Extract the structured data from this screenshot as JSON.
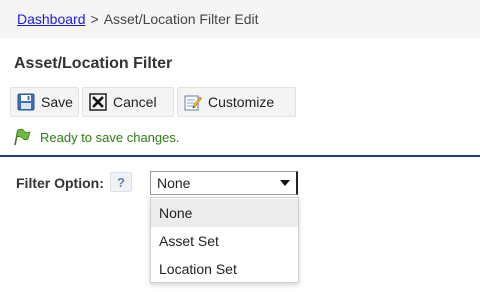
{
  "breadcrumb": {
    "home": "Dashboard",
    "separator": ">",
    "current": "Asset/Location Filter Edit"
  },
  "page_title": "Asset/Location Filter",
  "toolbar": {
    "save_label": "Save",
    "cancel_label": "Cancel",
    "customize_label": "Customize"
  },
  "status": {
    "message": "Ready to save changes.",
    "color": "#2e7d12"
  },
  "filter": {
    "label": "Filter Option:",
    "help": "?",
    "selected": "None",
    "options": [
      "None",
      "Asset Set",
      "Location Set"
    ]
  },
  "colors": {
    "link": "#1a1ae6",
    "divider": "#1f3f7a",
    "status": "#2e7d12"
  },
  "icons": {
    "save": "floppy-disk-icon",
    "cancel": "x-box-icon",
    "customize": "edit-pencil-icon",
    "status": "green-flag-icon",
    "help": "question-mark-icon"
  }
}
